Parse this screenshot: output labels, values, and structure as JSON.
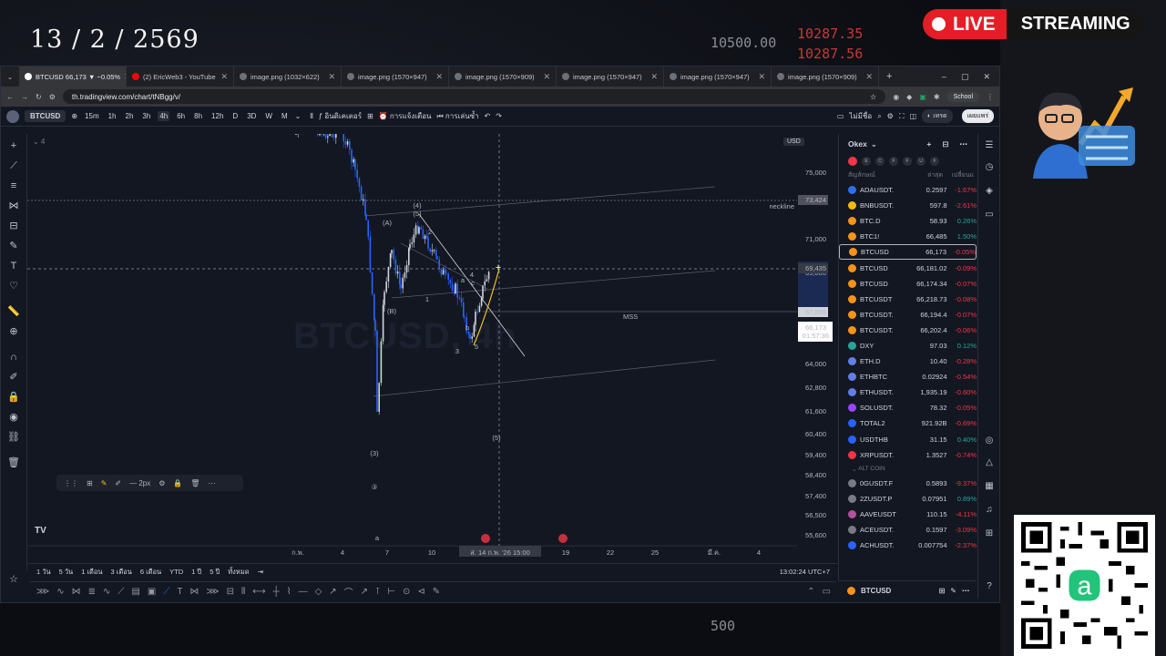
{
  "overlay": {
    "date": "13 / 2 / 2569",
    "live_label": "LIVE",
    "streaming_label": "STREAMING",
    "bg_numbers": [
      "10500.00",
      "10287.35",
      "10287.56",
      "500"
    ]
  },
  "browser": {
    "tabs": [
      {
        "label": "BTCUSD 66,173 ▼ −0.05%",
        "active": true
      },
      {
        "label": "(2) EricWeb3 - YouTube"
      },
      {
        "label": "image.png (1032×622)"
      },
      {
        "label": "image.png (1570×947)"
      },
      {
        "label": "image.png (1570×909)"
      },
      {
        "label": "image.png (1570×947)"
      },
      {
        "label": "image.png (1570×947)"
      },
      {
        "label": "image.png (1570×909)"
      }
    ],
    "url": "th.tradingview.com/chart/tNBgg/v/",
    "profile_label": "School"
  },
  "toolbar": {
    "symbol": "BTCUSD",
    "timeframes": [
      "15m",
      "1h",
      "2h",
      "3h",
      "4h",
      "6h",
      "8h",
      "12h",
      "D",
      "3D",
      "W",
      "M"
    ],
    "selected_tf": "4h",
    "indicators_label": "อินดิเคเตอร์",
    "alert_label": "การแจ้งเตือน",
    "replay_label": "การเล่นซ้ำ",
    "publish_label": "เผยแพร่",
    "save_label": "ไม่มีชื่อ"
  },
  "chart": {
    "watermark": "BTCUSD, 4h",
    "currency": "USD",
    "price_ticks": [
      "75,000",
      "71,000",
      "69,000",
      "65,000",
      "64,000",
      "62,800",
      "61,600",
      "60,400",
      "59,400",
      "58,400",
      "57,400",
      "56,500",
      "55,600"
    ],
    "neckline_label": "neckline",
    "neckline_price": "73,424",
    "crosshair_price": "69,435",
    "level_price": "67,008",
    "last_price": "66,173",
    "countdown": "01:57:36",
    "mss_label": "MSS",
    "time_ticks": [
      "ก.พ.",
      "4",
      "7",
      "10",
      "19",
      "22",
      "25",
      "มี.ค.",
      "4"
    ],
    "crosshair_time": "ส. 14 ก.พ. '26  15:00",
    "wave_labels": [
      "(4)",
      "(5)",
      "(A)",
      "(B)",
      "1",
      "2",
      "3",
      "4",
      "5",
      "a",
      "b",
      "c",
      "(3)",
      "(5)",
      "③",
      "a"
    ],
    "line_width_label": "2px"
  },
  "watchlist": {
    "title": "Okex",
    "col_symbol": "สัญลักษณ์",
    "col_last": "ล่าสุด",
    "col_change": "เปลี่ยนแ",
    "rows": [
      {
        "sym": "ADAUSDT.",
        "last": "0.2597",
        "chg": "-1.67%",
        "dir": "dn",
        "color": "#2e6ef2"
      },
      {
        "sym": "BNBUSDT.",
        "last": "597.8",
        "chg": "-2.61%",
        "dir": "dn",
        "color": "#f0b90b"
      },
      {
        "sym": "BTC.D",
        "last": "58.93",
        "chg": "0.26%",
        "dir": "up",
        "color": "#f7931a"
      },
      {
        "sym": "BTC1!",
        "last": "66,485",
        "chg": "1.50%",
        "dir": "up",
        "color": "#f7931a"
      },
      {
        "sym": "BTCUSD",
        "last": "66,173",
        "chg": "-0.05%",
        "dir": "dn",
        "color": "#f7931a"
      },
      {
        "sym": "BTCUSD",
        "last": "66,181.02",
        "chg": "-0.09%",
        "dir": "dn",
        "color": "#f7931a"
      },
      {
        "sym": "BTCUSD",
        "last": "66,174.34",
        "chg": "-0.07%",
        "dir": "dn",
        "color": "#f7931a"
      },
      {
        "sym": "BTCUSDT",
        "last": "66,218.73",
        "chg": "-0.08%",
        "dir": "dn",
        "color": "#f7931a"
      },
      {
        "sym": "BTCUSDT.",
        "last": "66,194.4",
        "chg": "-0.07%",
        "dir": "dn",
        "color": "#f7931a"
      },
      {
        "sym": "BTCUSDT.",
        "last": "66,202.4",
        "chg": "-0.06%",
        "dir": "dn",
        "color": "#f7931a"
      },
      {
        "sym": "DXY",
        "last": "97.03",
        "chg": "0.12%",
        "dir": "up",
        "color": "#26a69a"
      },
      {
        "sym": "ETH.D",
        "last": "10.40",
        "chg": "-0.28%",
        "dir": "dn",
        "color": "#627eea"
      },
      {
        "sym": "ETHBTC",
        "last": "0.02924",
        "chg": "-0.54%",
        "dir": "dn",
        "color": "#627eea"
      },
      {
        "sym": "ETHUSDT.",
        "last": "1,935.19",
        "chg": "-0.60%",
        "dir": "dn",
        "color": "#627eea"
      },
      {
        "sym": "SOLUSDT.",
        "last": "78.32",
        "chg": "-0.05%",
        "dir": "dn",
        "color": "#9945ff"
      },
      {
        "sym": "TOTAL2",
        "last": "921.92B",
        "chg": "-0.69%",
        "dir": "dn",
        "color": "#2962ff"
      },
      {
        "sym": "USDTHB",
        "last": "31.15",
        "chg": "0.40%",
        "dir": "up",
        "color": "#2962ff"
      },
      {
        "sym": "XRPUSDT.",
        "last": "1.3527",
        "chg": "-0.74%",
        "dir": "dn",
        "color": "#f23645"
      }
    ],
    "section_label": "ALT COIN",
    "rows2": [
      {
        "sym": "0GUSDT.F",
        "last": "0.5893",
        "chg": "-9.37%",
        "dir": "dn",
        "color": "#787b86"
      },
      {
        "sym": "2ZUSDT.P",
        "last": "0.07951",
        "chg": "0.89%",
        "dir": "up",
        "color": "#787b86"
      },
      {
        "sym": "AAVEUSDT",
        "last": "110.15",
        "chg": "-4.11%",
        "dir": "dn",
        "color": "#b6509e"
      },
      {
        "sym": "ACEUSDT.",
        "last": "0.1597",
        "chg": "-3.09%",
        "dir": "dn",
        "color": "#787b86"
      },
      {
        "sym": "ACHUSDT.",
        "last": "0.007754",
        "chg": "-2.37%",
        "dir": "dn",
        "color": "#2962ff"
      }
    ],
    "bottom_symbol": "BTCUSD"
  },
  "rangebar": {
    "ranges": [
      "1 วัน",
      "5 วัน",
      "1 เดือน",
      "3 เดือน",
      "6 เดือน",
      "YTD",
      "1 ปี",
      "5 ปี",
      "ทั้งหมด"
    ],
    "clock": "13:02:24 UTC+7"
  }
}
